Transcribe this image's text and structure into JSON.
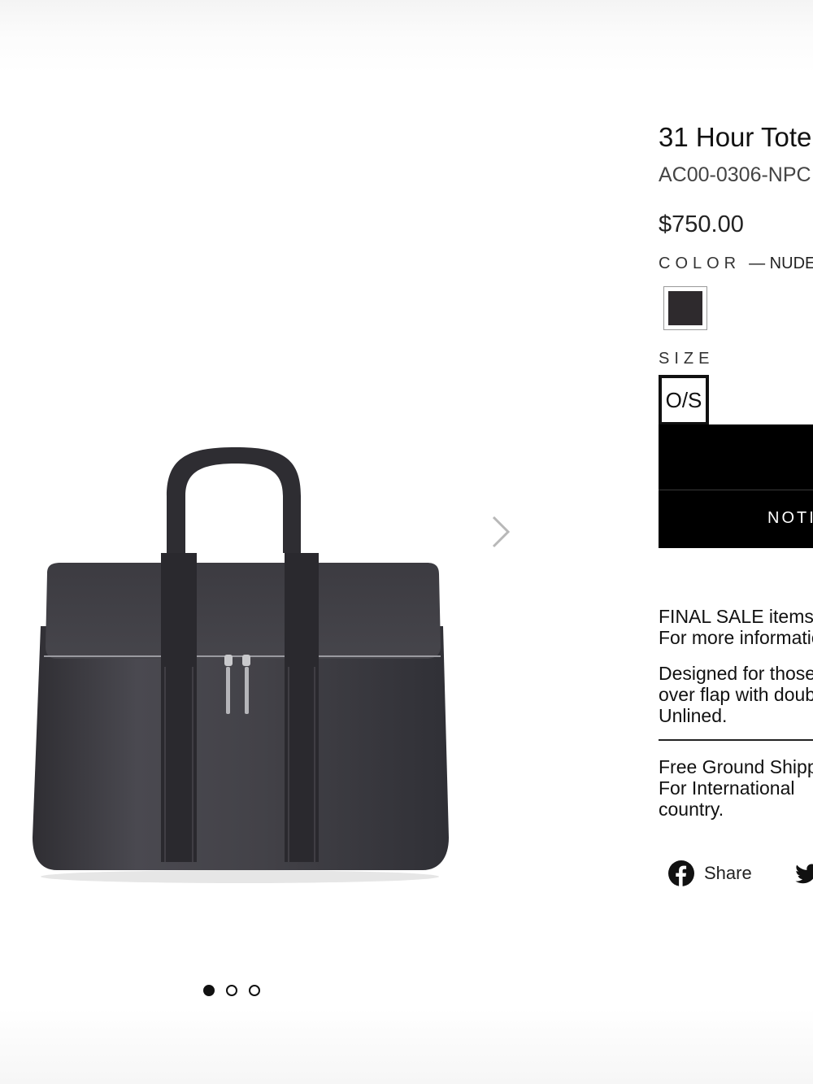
{
  "product": {
    "title": "31 Hour Tote",
    "sku": "AC00-0306-NPC",
    "price": "$750.00",
    "color_label": "COLOR",
    "color_value": "— NUDE",
    "swatch_color": "#2e2a2d",
    "size_label": "SIZE",
    "size_value": "O/S",
    "cta_label": "NOTI"
  },
  "description": {
    "final_sale_line1": "FINAL SALE items",
    "final_sale_line2": "For more information",
    "body_line1": "Designed for those",
    "body_line2": "over flap with double",
    "body_line3": "Unlined."
  },
  "shipping": {
    "line1": "Free Ground Shipping",
    "line2": "For International",
    "line3": "country."
  },
  "social": {
    "share_label": "Share"
  },
  "gallery": {
    "image_count": 3,
    "active_index": 0
  }
}
